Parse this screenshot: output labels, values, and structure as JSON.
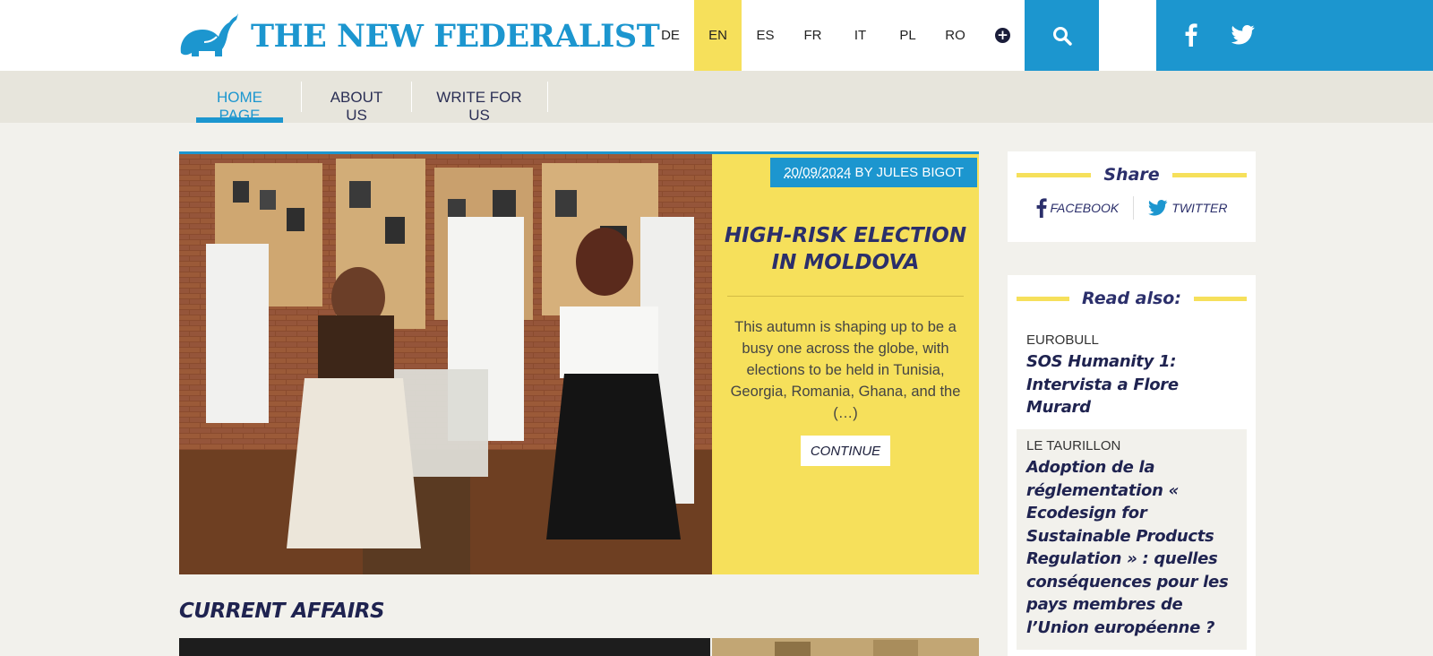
{
  "header": {
    "site_name": "THE NEW FEDERALIST",
    "languages": [
      {
        "code": "DE",
        "active": false
      },
      {
        "code": "EN",
        "active": true
      },
      {
        "code": "ES",
        "active": false
      },
      {
        "code": "FR",
        "active": false
      },
      {
        "code": "IT",
        "active": false
      },
      {
        "code": "PL",
        "active": false
      },
      {
        "code": "RO",
        "active": false
      }
    ],
    "more_languages_icon": "plus-circle-icon",
    "search_icon": "search-icon",
    "social_icons": [
      "facebook-icon",
      "twitter-icon"
    ]
  },
  "nav": {
    "items": [
      {
        "label": "HOME PAGE",
        "active": true
      },
      {
        "label": "ABOUT US",
        "active": false
      },
      {
        "label": "WRITE FOR US",
        "active": false
      }
    ]
  },
  "featured": {
    "date": "20/09/2024",
    "byline": " BY JULES BIGOT",
    "title_line1": "HIGH-RISK ELECTION",
    "title_line2": "IN MOLDOVA",
    "summary": "This autumn is shaping up to be a busy one across the globe, with elections to be held in Tunisia, Georgia, Romania, Ghana, and the (…)",
    "continue_label": "CONTINUE"
  },
  "sections": {
    "current_affairs": "CURRENT AFFAIRS"
  },
  "sidebar": {
    "share": {
      "heading": "Share",
      "facebook_label": "FACEBOOK",
      "twitter_label": "TWITTER"
    },
    "read_also": {
      "heading": "Read also:",
      "items": [
        {
          "source": "EUROBULL",
          "title": "SOS Humanity 1: Intervista a Flore Murard"
        },
        {
          "source": "LE TAURILLON",
          "title": "Adoption de la réglementation « Ecodesign for Sustainable Products Regulation » : quelles conséquences pour les pays membres de l’Union européenne ?"
        }
      ]
    }
  },
  "colors": {
    "brand_blue": "#1c96cf",
    "accent_yellow": "#f6e05b",
    "navy_text": "#2b2f6b",
    "page_bg": "#f2f1ec",
    "nav_bg": "#e7e5dc"
  }
}
